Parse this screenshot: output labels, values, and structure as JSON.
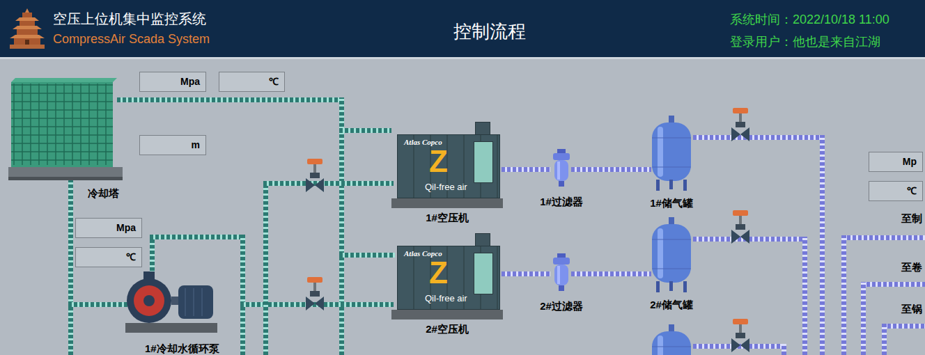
{
  "header": {
    "title": "空压上位机集中监控系统",
    "subtitle": "CompressAir Scada System",
    "page_title": "控制流程",
    "time_label": "系统时间：",
    "time": "2022/10/18 11:00",
    "user_label": "登录用户：",
    "user": "他也是来自江湖"
  },
  "readouts": [
    {
      "unit": "Mpa"
    },
    {
      "unit": "℃"
    },
    {
      "unit": "m"
    },
    {
      "unit": "Mpa"
    },
    {
      "unit": "℃"
    },
    {
      "unit": "Mp"
    },
    {
      "unit": "℃"
    }
  ],
  "cooling_tower": {
    "label": "冷却塔"
  },
  "pump": {
    "label": "1#冷却水循环泵"
  },
  "compressors": [
    {
      "label": "1#空压机",
      "brand": "Atlas Copco",
      "mark": "Z",
      "caption": "Qil-free air"
    },
    {
      "label": "2#空压机",
      "brand": "Atlas Copco",
      "mark": "Z",
      "caption": "Qil-free air"
    }
  ],
  "filters": [
    {
      "label": "1#过滤器"
    },
    {
      "label": "2#过滤器"
    }
  ],
  "tanks": [
    {
      "label": "1#储气罐"
    },
    {
      "label": "2#储气罐"
    }
  ],
  "destinations": [
    {
      "label": "至制"
    },
    {
      "label": "至卷"
    },
    {
      "label": "至锅"
    }
  ]
}
